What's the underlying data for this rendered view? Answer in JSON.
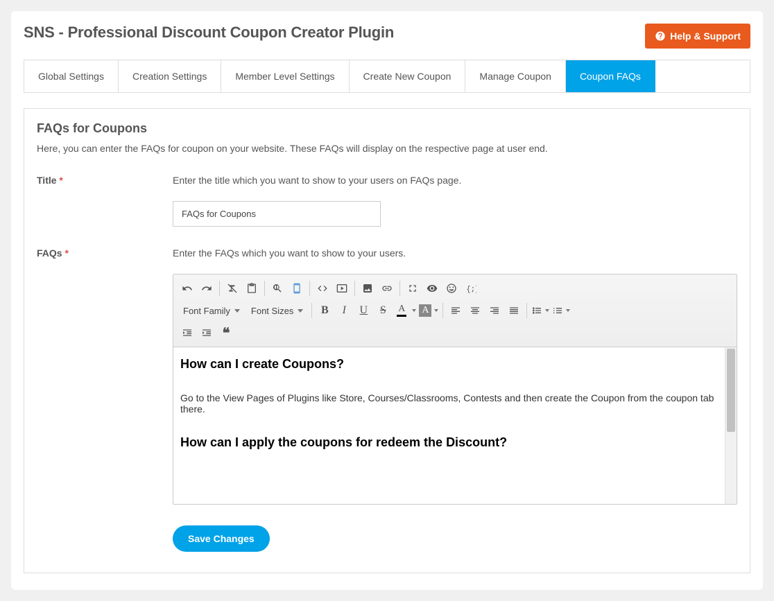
{
  "header": {
    "title": "SNS - Professional Discount Coupon Creator Plugin",
    "help_label": "Help & Support"
  },
  "tabs": [
    {
      "label": "Global Settings",
      "active": false
    },
    {
      "label": "Creation Settings",
      "active": false
    },
    {
      "label": "Member Level Settings",
      "active": false
    },
    {
      "label": "Create New Coupon",
      "active": false
    },
    {
      "label": "Manage Coupon",
      "active": false
    },
    {
      "label": "Coupon FAQs",
      "active": true
    }
  ],
  "section": {
    "heading": "FAQs for Coupons",
    "description": "Here, you can enter the FAQs for coupon on your website. These FAQs will display on the respective page at user end."
  },
  "fields": {
    "title": {
      "label": "Title",
      "required": "*",
      "hint": "Enter the title which you want to show to your users on FAQs page.",
      "value": "FAQs for Coupons"
    },
    "faqs": {
      "label": "FAQs",
      "required": "*",
      "hint": "Enter the FAQs which you want to show to your users."
    }
  },
  "toolbar": {
    "font_family_label": "Font Family",
    "font_sizes_label": "Font Sizes"
  },
  "editor_content": {
    "q1": "How can I create Coupons?",
    "a1": "Go to the View Pages of Plugins like Store, Courses/Classrooms, Contests and then create the Coupon from the coupon tab there.",
    "q2": "How can I apply the coupons for redeem the Discount?"
  },
  "buttons": {
    "save": "Save Changes"
  }
}
